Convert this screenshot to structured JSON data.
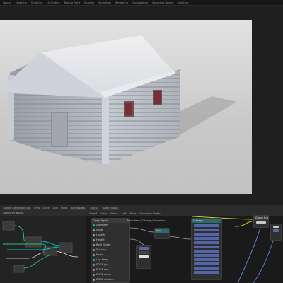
{
  "topbar": {
    "items": [
      "Layout",
      "Modeling",
      "Sculpting",
      "UV Editing",
      "Texture Paint",
      "Shading",
      "Animation",
      "Rendering",
      "Compositing",
      "Geometry Nodes",
      "Scripting"
    ]
  },
  "viewport": {
    "subject": "3D render of a snow-covered log cabin with a gabled roof, door and two small windows"
  },
  "divider": {
    "left_label": "Cabin_Generator_V4",
    "items": [
      "View",
      "Select",
      "Add",
      "Node",
      "Use Nodes",
      "Slot 1",
      "Cabin_Base"
    ]
  },
  "node_left": {
    "header": "Geometry Nodes",
    "colors": {
      "green": "#2fbf71",
      "cyan": "#00c2c2",
      "white": "#e6e6e6"
    }
  },
  "node_main": {
    "header_items": [
      "Object",
      "View",
      "Select",
      "Add",
      "Node",
      "Geometry Nodes"
    ],
    "breadcrumb": "Mountains_Cottage_Generator",
    "input_node": {
      "title": "Group Input",
      "rows": [
        "Geometry",
        "Width",
        "Length",
        "Height",
        "Roof Height",
        "Spacing",
        "Noise",
        "Log Array",
        "EDGE y/n",
        "EDGE size",
        "EDGE count",
        "EDGE rotation"
      ]
    },
    "small_node": {
      "title": "Join"
    },
    "center_node": {
      "title": "Cottage"
    },
    "right_node": {
      "title": "Group Output"
    },
    "accent_colors": {
      "link_blue": "#5b7fd1",
      "link_yellow": "#d8c23a",
      "header_teal": "#2b6a6a"
    }
  }
}
